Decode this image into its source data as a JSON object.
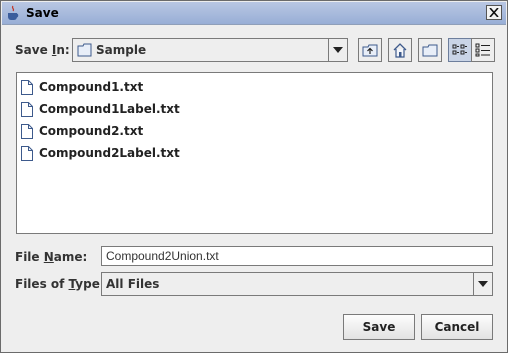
{
  "window": {
    "title": "Save",
    "icon": "java-coffee-icon",
    "close": "close-icon"
  },
  "save_in": {
    "label_prefix": "Save ",
    "label_mnemonic": "I",
    "label_suffix": "n:",
    "value": "Sample",
    "icon": "folder-icon"
  },
  "toolbar": {
    "buttons": [
      "up-one-level-icon",
      "home-icon",
      "new-folder-icon",
      "list-view-icon",
      "details-view-icon"
    ]
  },
  "files": [
    {
      "name": "Compound1.txt",
      "icon": "file-icon"
    },
    {
      "name": "Compound1Label.txt",
      "icon": "file-icon"
    },
    {
      "name": "Compound2.txt",
      "icon": "file-icon"
    },
    {
      "name": "Compound2Label.txt",
      "icon": "file-icon"
    }
  ],
  "file_name": {
    "label_prefix": "File ",
    "label_mnemonic": "N",
    "label_suffix": "ame:",
    "value": "Compound2Union.txt"
  },
  "file_type": {
    "label_prefix": "Files of ",
    "label_mnemonic": "T",
    "label_suffix": "ype:",
    "value": "All Files"
  },
  "actions": {
    "save": "Save",
    "cancel": "Cancel"
  }
}
